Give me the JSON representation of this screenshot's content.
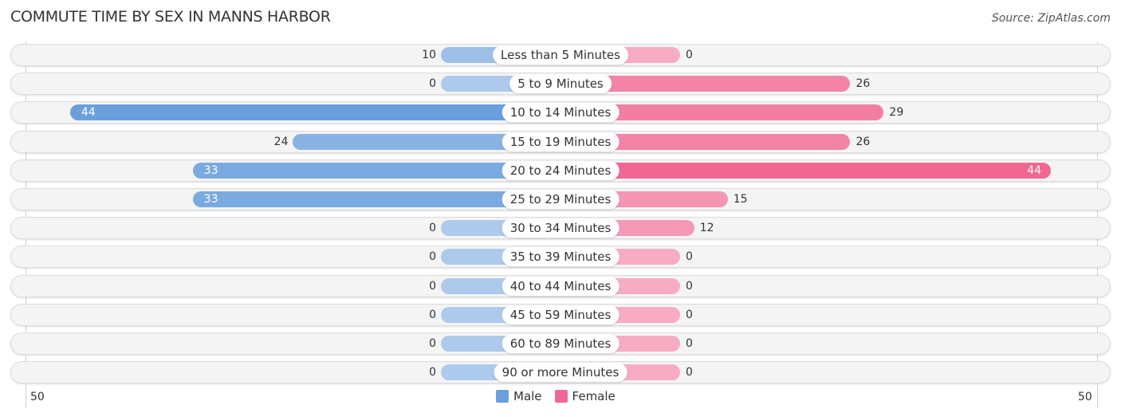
{
  "chart_data": {
    "type": "bar",
    "orientation": "horizontal-diverging",
    "title": "COMMUTE TIME BY SEX IN MANNS HARBOR",
    "source": "Source: ZipAtlas.com",
    "categories": [
      "Less than 5 Minutes",
      "5 to 9 Minutes",
      "10 to 14 Minutes",
      "15 to 19 Minutes",
      "20 to 24 Minutes",
      "25 to 29 Minutes",
      "30 to 34 Minutes",
      "35 to 39 Minutes",
      "40 to 44 Minutes",
      "45 to 59 Minutes",
      "60 to 89 Minutes",
      "90 or more Minutes"
    ],
    "series": [
      {
        "name": "Male",
        "color": "#6a9fdc",
        "values": [
          10,
          0,
          44,
          24,
          33,
          33,
          0,
          0,
          0,
          0,
          0,
          0
        ]
      },
      {
        "name": "Female",
        "color": "#f06892",
        "values": [
          0,
          26,
          29,
          26,
          44,
          15,
          12,
          0,
          0,
          0,
          0,
          0
        ]
      }
    ],
    "xlim": [
      -50,
      50
    ],
    "tick_labels": {
      "left": "50",
      "right": "50"
    },
    "legend": {
      "position": "bottom-center",
      "items": [
        "Male",
        "Female"
      ]
    }
  }
}
